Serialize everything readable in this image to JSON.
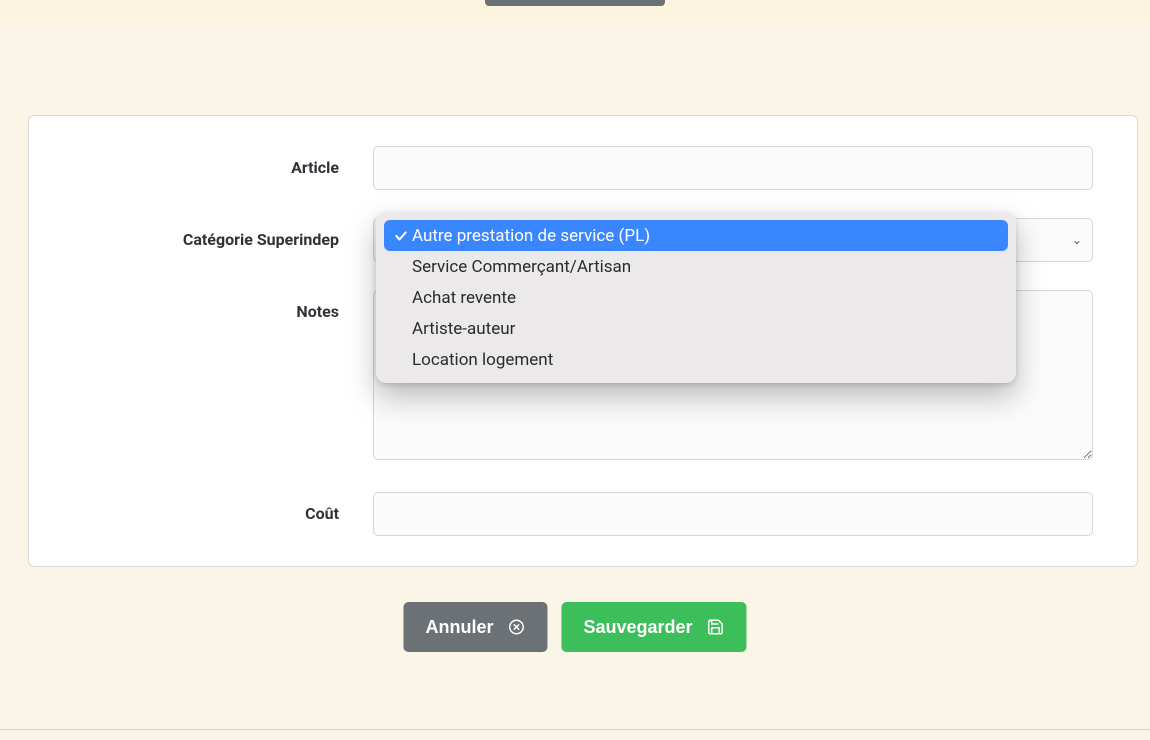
{
  "form": {
    "article": {
      "label": "Article",
      "value": ""
    },
    "category": {
      "label": "Catégorie Superindep",
      "selected": "Autre prestation de service (PL)",
      "options": [
        "Autre prestation de service (PL)",
        "Service Commerçant/Artisan",
        "Achat revente",
        "Artiste-auteur",
        "Location logement"
      ]
    },
    "notes": {
      "label": "Notes",
      "value": ""
    },
    "cost": {
      "label": "Coût",
      "value": ""
    }
  },
  "buttons": {
    "cancel": "Annuler",
    "save": "Sauvegarder"
  }
}
